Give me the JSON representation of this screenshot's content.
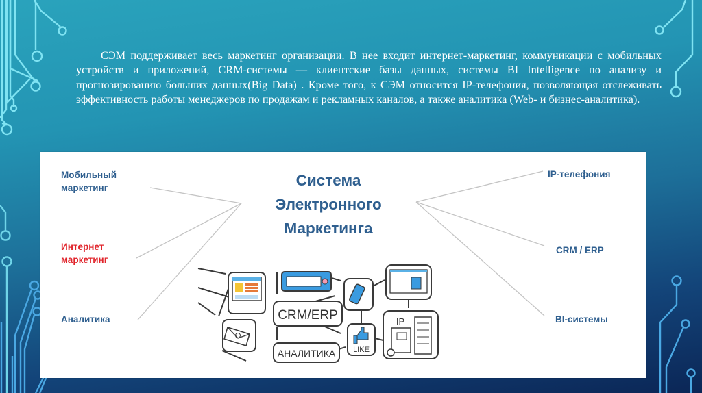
{
  "slide": {
    "paragraph": "СЭМ поддерживает весь маркетинг организации. В нее входит интернет-маркетинг, коммуникации с мобильных устройств и приложений, CRM-системы — клиентские базы данных, системы BI Intelligence по анализу и прогнозированию больших данных(Big Data) . Кроме того, к СЭМ относится IP-телефония, позволяющая отслеживать эффективность работы менеджеров по продажам и рекламных каналов, а также аналитика (Web- и бизнес-аналитика)."
  },
  "diagram": {
    "title_lines": [
      "Система",
      "Электронного",
      "Маркетинга"
    ],
    "left_items": [
      {
        "lines": [
          "Мобильный",
          "маркетинг"
        ],
        "color": "#2f5f8f"
      },
      {
        "lines": [
          "Интернет",
          "маркетинг"
        ],
        "color": "#e0242b"
      },
      {
        "lines": [
          "Аналитика"
        ],
        "color": "#2f5f8f"
      }
    ],
    "right_items": [
      {
        "lines": [
          "IP-телефония"
        ],
        "color": "#2f5f8f"
      },
      {
        "lines": [
          "CRM / ERP"
        ],
        "color": "#2f5f8f"
      },
      {
        "lines": [
          "BI-системы"
        ],
        "color": "#2f5f8f"
      }
    ],
    "illustration": {
      "center_label": "CRM/ERP",
      "bottom_label": "АНАЛИТИКА",
      "like_label": "LIKE",
      "ip_label": "IP",
      "icons": [
        "website-icon",
        "search-bar-icon",
        "mobile-phone-icon",
        "web-page-icon",
        "email-icon",
        "like-icon",
        "ip-phone-server-icon"
      ]
    }
  },
  "colors": {
    "text_blue": "#2f5f8f",
    "text_red": "#e0242b",
    "circuit_light": "#7fe3f2",
    "circuit_dark": "#4a9fd8"
  }
}
